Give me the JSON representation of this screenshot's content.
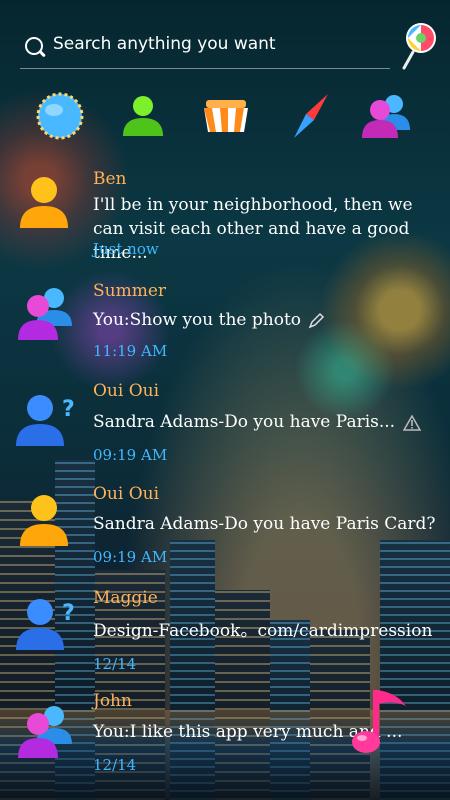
{
  "search": {
    "placeholder": "Search anything you want"
  },
  "dock": {
    "icons": [
      "globe-icon",
      "contacts-icon",
      "store-icon",
      "compass-icon",
      "group-contacts-icon"
    ]
  },
  "threads": [
    {
      "name": "Ben",
      "message": "I'll be in your neighborhood,  then we can visit each other and have a good time...",
      "time": "Just now"
    },
    {
      "name": "Summer",
      "message": "You:Show you the photo",
      "time": "11:19 AM"
    },
    {
      "name": "Oui Oui",
      "message": "Sandra Adams-Do you have Paris...",
      "time": "09:19 AM"
    },
    {
      "name": "Oui Oui",
      "message": "Sandra Adams-Do you have Paris Card?",
      "time": "09:19 AM"
    },
    {
      "name": "Maggie",
      "message": "Design-Facebook。com/cardimpression",
      "time": "12/14"
    },
    {
      "name": "John",
      "message": "You:I like this app very much and ...",
      "time": "12/14"
    }
  ],
  "colors": {
    "name": "#ffb25a",
    "time": "#3fb8ff",
    "text": "#ffffff"
  }
}
